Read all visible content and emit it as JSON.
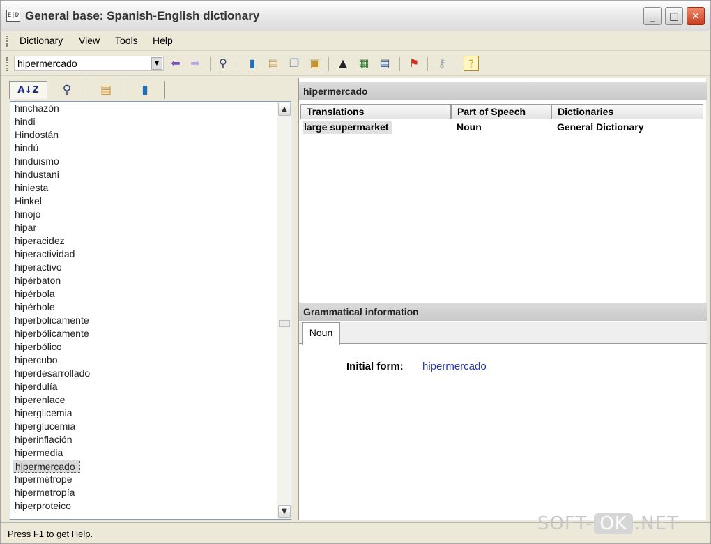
{
  "window": {
    "title": "General base: Spanish-English dictionary",
    "icon_text": "E|D",
    "minimize_glyph": "_",
    "maximize_glyph": "□",
    "close_glyph": "✕"
  },
  "menu": [
    "Dictionary",
    "View",
    "Tools",
    "Help"
  ],
  "toolbar": {
    "search_value": "hipermercado",
    "combo_arrow": "▼",
    "icons": [
      "back-arrow",
      "forward-arrow",
      "binoculars",
      "book-blue",
      "book-paste",
      "copy",
      "paste",
      "graduation-cap",
      "crossword",
      "text-view",
      "pin",
      "key",
      "help"
    ]
  },
  "left_tabs": {
    "icons": [
      "sort-az",
      "binoculars",
      "card-list",
      "book-blue"
    ]
  },
  "word_list": {
    "items": [
      "hinchazón",
      "hindi",
      "Hindostán",
      "hindú",
      "hinduismo",
      "hindustani",
      "hiniesta",
      "Hinkel",
      "hinojo",
      "hipar",
      "hiperacidez",
      "hiperactividad",
      "hiperactivo",
      "hipérbaton",
      "hipérbola",
      "hipérbole",
      "hiperbolicamente",
      "hiperbólicamente",
      "hiperbólico",
      "hipercubo",
      "hiperdesarrollado",
      "hiperdulía",
      "hiperenlace",
      "hiperglicemia",
      "hiperglucemia",
      "hiperinflación",
      "hipermedia",
      "hipermercado",
      "hipermétrope",
      "hipermetropía",
      "hiperproteico"
    ],
    "selected": "hipermercado",
    "scroll_up": "▲",
    "scroll_down": "▼"
  },
  "translation": {
    "header": "hipermercado",
    "columns": [
      "Translations",
      "Part of Speech",
      "Dictionaries"
    ],
    "rows": [
      {
        "translation": "large supermarket",
        "pos": "Noun",
        "dictionary": "General Dictionary"
      }
    ]
  },
  "grammar": {
    "header": "Grammatical information",
    "tab": "Noun",
    "initial_form_label": "Initial form:",
    "initial_form_value": "hipermercado"
  },
  "status": {
    "text": "Press F1 to get Help."
  },
  "watermark": {
    "pre": "SOFT-",
    "box": "OK",
    "post": ".NET"
  }
}
